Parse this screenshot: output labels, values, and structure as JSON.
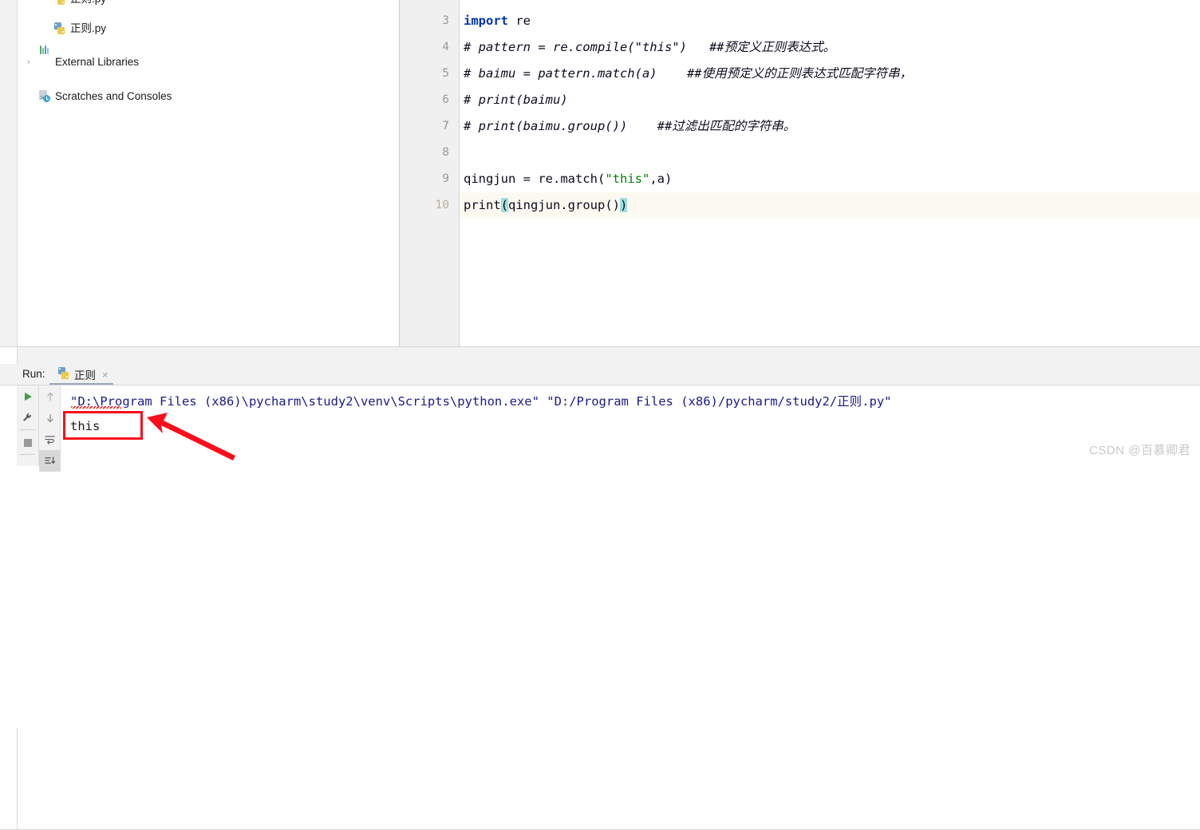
{
  "sidebar": {
    "items": [
      {
        "label": "正则.py",
        "icon": "python-file-icon",
        "indent": 45,
        "arrow": "",
        "cut": true
      },
      {
        "label": "正则.py",
        "icon": "python-file-icon",
        "indent": 45,
        "arrow": ""
      },
      {
        "label": "External Libraries",
        "icon": "libraries-icon",
        "indent": 26,
        "arrow": "›"
      },
      {
        "label": "Scratches and Consoles",
        "icon": "scratches-icon",
        "indent": 26,
        "arrow": ""
      }
    ]
  },
  "editor": {
    "lines": [
      {
        "num": "3",
        "current": false
      },
      {
        "num": "4",
        "current": false
      },
      {
        "num": "5",
        "current": false
      },
      {
        "num": "6",
        "current": false
      },
      {
        "num": "7",
        "current": false
      },
      {
        "num": "8",
        "current": false
      },
      {
        "num": "9",
        "current": false
      },
      {
        "num": "10",
        "current": true
      }
    ],
    "code": {
      "l3_kw": "import",
      "l3_rest": " re",
      "l4": "# pattern = re.compile(\"this\")   ##预定义正则表达式。",
      "l5": "# baimu = pattern.match(a)    ##使用预定义的正则表达式匹配字符串，",
      "l6": "# print(baimu)",
      "l7": "# print(baimu.group())    ##过滤出匹配的字符串。",
      "l8": "",
      "l9_a": "qingjun = re.match(",
      "l9_str": "\"this\"",
      "l9_b": ",a)",
      "l10_a": "print",
      "l10_p1": "(",
      "l10_b": "qingjun.group()",
      "l10_p2": ")"
    }
  },
  "run_panel": {
    "run_label": "Run:",
    "tab_title": "正则",
    "tab_close": "×",
    "toolbar": [
      {
        "name": "run-button",
        "glyph": "run"
      },
      {
        "name": "settings-wrench-button",
        "glyph": "wrench"
      },
      {
        "name": "stop-button",
        "glyph": "stop"
      },
      {
        "name": "prev-occurrence-button",
        "glyph": "arrow-up"
      },
      {
        "name": "next-occurrence-button",
        "glyph": "arrow-down"
      },
      {
        "name": "soft-wrap-button",
        "glyph": "wrap"
      },
      {
        "name": "scroll-to-end-button",
        "glyph": "scroll-end"
      }
    ],
    "console": {
      "command": "\"D:\\Program Files (x86)\\pycharm\\study2\\venv\\Scripts\\python.exe\" \"D:/Program Files (x86)/pycharm/study2/正则.py\"",
      "output": "this"
    }
  },
  "annotation": {
    "box_target": "this",
    "color": "#fc0d1c"
  },
  "watermark": {
    "text": "CSDN @百慕卿君"
  }
}
